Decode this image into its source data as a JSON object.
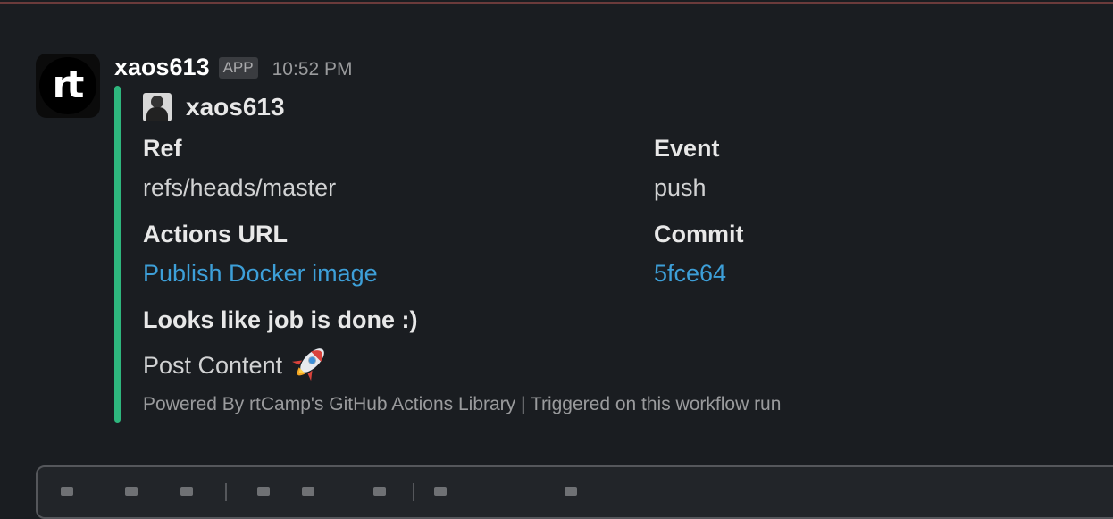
{
  "message": {
    "sender": "xaos613",
    "badge": "APP",
    "timestamp": "10:52 PM",
    "avatar_text": "rt"
  },
  "attachment": {
    "author": "xaos613",
    "accent_color": "#2eb67d",
    "fields": {
      "ref": {
        "title": "Ref",
        "value": "refs/heads/master"
      },
      "event": {
        "title": "Event",
        "value": "push"
      },
      "actions_url": {
        "title": "Actions URL",
        "value": "Publish Docker image"
      },
      "commit": {
        "title": "Commit",
        "value": "5fce64"
      },
      "status": {
        "title": "Looks like job is done :)",
        "value": "Post Content"
      }
    },
    "status_icon": "rocket-icon",
    "footer": "Powered By rtCamp's GitHub Actions Library | Triggered on this workflow run"
  },
  "colors": {
    "background": "#1a1d21",
    "link": "#3d9fd8"
  }
}
